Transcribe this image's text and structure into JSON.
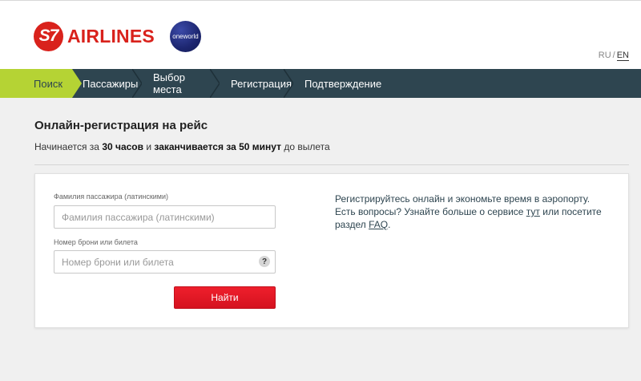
{
  "header": {
    "logo_mark": "S7",
    "logo_text": "AIRLINES",
    "alliance": "oneworld",
    "lang": {
      "ru": "RU",
      "separator": "/",
      "en": "EN"
    }
  },
  "steps": [
    {
      "label": "Поиск",
      "active": true
    },
    {
      "label": "Пассажиры",
      "active": false
    },
    {
      "label": "Выбор места",
      "active": false
    },
    {
      "label": "Регистрация",
      "active": false
    },
    {
      "label": "Подтверждение",
      "active": false
    }
  ],
  "main": {
    "title": "Онлайн-регистрация на рейс",
    "subtitle": {
      "part1": "Начинается за ",
      "bold1": "30 часов",
      "part2": " и ",
      "bold2": "заканчивается за 50 минут",
      "part3": " до вылета"
    }
  },
  "form": {
    "surname_label": "Фамилия пассажира (латинскими)",
    "surname_placeholder": "Фамилия пассажира (латинскими)",
    "surname_value": "",
    "booking_label": "Номер брони или билета",
    "booking_placeholder": "Номер брони или билета",
    "booking_value": "",
    "help_glyph": "?",
    "submit_label": "Найти"
  },
  "info": {
    "text1": "Регистрируйтесь онлайн и экономьте время в аэропорту. Есть вопросы? Узнайте больше о сервисе ",
    "link1": "тут",
    "text2": " или посетите раздел ",
    "link2": "FAQ",
    "text3": "."
  },
  "colors": {
    "brand_red": "#d9221c",
    "nav_bg": "#2e4550",
    "nav_active": "#b5d334",
    "button_red": "#e2101e"
  }
}
